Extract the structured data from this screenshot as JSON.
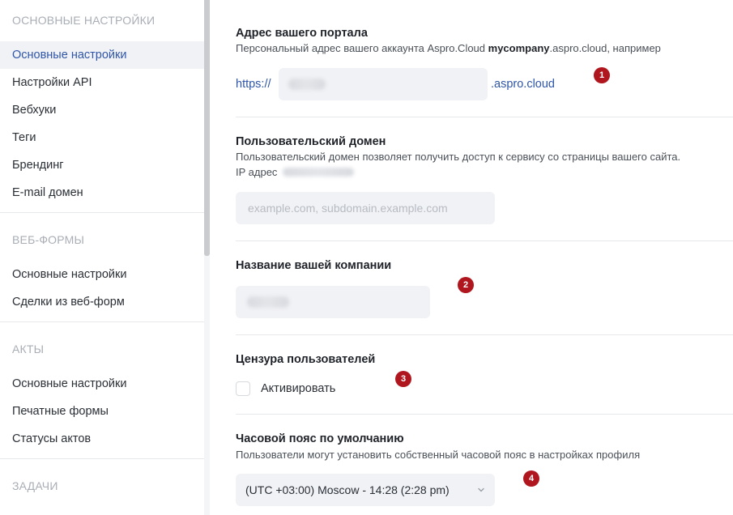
{
  "sidebar": {
    "sections": [
      {
        "title": "ОСНОВНЫЕ НАСТРОЙКИ",
        "items": [
          "Основные настройки",
          "Настройки API",
          "Вебхуки",
          "Теги",
          "Брендинг",
          "E-mail домен"
        ]
      },
      {
        "title": "ВЕБ-ФОРМЫ",
        "items": [
          "Основные настройки",
          "Сделки из веб-форм"
        ]
      },
      {
        "title": "АКТЫ",
        "items": [
          "Основные настройки",
          "Печатные формы",
          "Статусы актов"
        ]
      },
      {
        "title": "ЗАДАЧИ",
        "items": []
      }
    ],
    "active_item": "Основные настройки"
  },
  "portal": {
    "title": "Адрес вашего портала",
    "desc_prefix": "Персональный адрес вашего аккаунта Aspro.Cloud ",
    "desc_bold": "mycompany",
    "desc_suffix": ".aspro.cloud, например",
    "protocol": "https://",
    "domain_suffix": ".aspro.cloud",
    "badge": "1"
  },
  "custom_domain": {
    "title": "Пользовательский домен",
    "desc": "Пользовательский домен позволяет получить доступ к сервису со страницы вашего сайта.",
    "ip_label": "IP адрес",
    "placeholder": "example.com, subdomain.example.com"
  },
  "company": {
    "title": "Название вашей компании",
    "badge": "2"
  },
  "censorship": {
    "title": "Цензура пользователей",
    "checkbox_label": "Активировать",
    "checked": false,
    "badge": "3"
  },
  "timezone": {
    "title": "Часовой пояс по умолчанию",
    "desc": "Пользователи могут установить собственный часовой пояс в настройках профиля",
    "selected": "(UTC +03:00) Moscow - 14:28 (2:28 pm)",
    "badge": "4"
  },
  "colors": {
    "accent": "#2f56a8",
    "badge": "#b0161e",
    "input_bg": "#f1f2f6",
    "muted": "#a9aeb6"
  }
}
